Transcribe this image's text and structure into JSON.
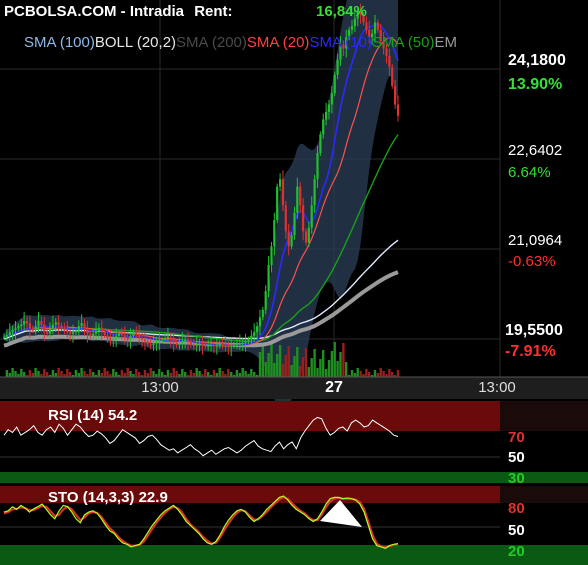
{
  "header": {
    "title": "PCBOLSA.COM - Intradia",
    "rent_label": "Rent:",
    "rent_value": "16,84%"
  },
  "legend": [
    {
      "label": "SMA (100)",
      "color": "#8fb8ea"
    },
    {
      "label": "BOLL (20,2)",
      "color": "#e6e6e6"
    },
    {
      "label": "SMA (200)",
      "color": "#4a4a4a"
    },
    {
      "label": "SMA (20)",
      "color": "#ff4040"
    },
    {
      "label": "SMA (10)",
      "color": "#2a2aff"
    },
    {
      "label": "SMA (50)",
      "color": "#18a018"
    },
    {
      "label": "EM",
      "color": "#9a9a9a"
    }
  ],
  "price_axis": [
    {
      "price": "24,1800",
      "pct": "13.90%",
      "pct_color": "#33e033"
    },
    {
      "price": "22,6402",
      "pct": "6.64%",
      "pct_color": "#33e033"
    },
    {
      "price": "21,0964",
      "pct": "-0.63%",
      "pct_color": "#ff3030"
    },
    {
      "price": "19,5500",
      "pct": "-7.91%",
      "pct_color": "#ff3030"
    }
  ],
  "time_axis": [
    "13:00",
    "27",
    "13:00"
  ],
  "rsi": {
    "label": "RSI (14) 54.2",
    "levels": [
      "70",
      "50",
      "30"
    ],
    "level_colors": [
      "#e03030",
      "#ffffff",
      "#22cc22"
    ]
  },
  "sto": {
    "label": "STO (14,3,3) 22.9",
    "levels": [
      "80",
      "50",
      "20"
    ],
    "level_colors": [
      "#e03030",
      "#ffffff",
      "#22cc22"
    ]
  },
  "chart_data": [
    {
      "type": "candlestick",
      "title": "PCBOLSA.COM - Intradia",
      "ylim": [
        19.3,
        24.35
      ],
      "yticks": [
        24.18,
        22.6402,
        21.0964,
        19.55
      ],
      "xticks": [
        "13:00",
        "27",
        "13:00"
      ],
      "close_series": [
        19.84,
        19.86,
        19.9,
        19.93,
        19.95,
        19.98,
        20.0,
        20.05,
        20.02,
        19.95,
        19.93,
        19.98,
        20.05,
        20.0,
        19.9,
        19.88,
        19.95,
        20.0,
        20.03,
        19.99,
        19.95,
        19.93,
        19.9,
        19.88,
        19.9,
        19.92,
        19.98,
        20.02,
        19.95,
        19.88,
        19.85,
        19.88,
        19.92,
        19.96,
        19.9,
        19.86,
        19.82,
        19.8,
        19.82,
        19.85,
        19.88,
        19.86,
        19.83,
        19.8,
        19.85,
        19.9,
        19.88,
        19.83,
        19.8,
        19.78,
        19.74,
        19.73,
        19.75,
        19.78,
        19.8,
        19.8,
        19.82,
        19.84,
        19.8,
        19.76,
        19.73,
        19.75,
        19.78,
        19.8,
        19.78,
        19.73,
        19.72,
        19.74,
        19.75,
        19.72,
        19.71,
        19.72,
        19.73,
        19.72,
        19.72,
        19.75,
        19.73,
        19.72,
        19.7,
        19.72,
        19.73,
        19.74,
        19.75,
        19.76,
        19.78,
        19.8,
        19.85,
        19.9,
        19.98,
        20.1,
        20.2,
        20.45,
        20.8,
        21.05,
        21.4,
        21.85,
        21.95,
        21.6,
        21.25,
        21.05,
        21.2,
        21.5,
        21.85,
        21.6,
        21.25,
        21.1,
        21.3,
        21.6,
        21.95,
        22.3,
        22.55,
        22.75,
        22.85,
        22.95,
        23.1,
        23.35,
        23.55,
        23.75,
        23.7,
        23.85,
        23.95,
        24.0,
        24.1,
        24.2,
        24.15,
        24.05,
        23.95,
        23.85,
        23.9,
        24.05,
        23.95,
        23.8,
        23.7,
        23.6,
        23.45,
        23.2,
        22.95,
        22.8
      ],
      "volume": "bars shown below price in green/red",
      "overlays": [
        "SMA (100)",
        "BOLL (20,2)",
        "SMA (200)",
        "SMA (20)",
        "SMA (10)",
        "SMA (50)"
      ]
    },
    {
      "type": "line",
      "title": "RSI (14) 54.2",
      "ylim": [
        20,
        80
      ],
      "levels": [
        70,
        50,
        30
      ],
      "series": [
        {
          "name": "RSI (14)",
          "values": [
            55,
            59,
            57,
            61,
            55,
            57,
            59,
            62,
            57,
            55,
            59,
            61,
            57,
            63,
            60,
            55,
            59,
            63,
            61,
            57,
            54,
            55,
            58,
            56,
            53,
            49,
            51,
            55,
            59,
            57,
            55,
            53,
            49,
            51,
            54,
            55,
            52,
            48,
            46,
            44,
            45,
            42,
            44,
            46,
            48,
            45,
            43,
            40,
            42,
            44,
            41,
            43,
            45,
            46,
            44,
            42,
            44,
            47,
            49,
            51,
            47,
            45,
            44,
            43,
            47,
            50,
            45,
            48,
            50,
            45,
            53,
            58,
            62,
            66,
            68,
            67,
            60,
            55,
            57,
            60,
            61,
            58,
            64,
            66,
            64,
            61,
            62,
            66,
            64,
            62,
            60,
            58,
            55,
            54
          ]
        }
      ]
    },
    {
      "type": "line",
      "title": "STO (14,3,3) 22.9",
      "ylim": [
        0,
        100
      ],
      "levels": [
        80,
        50,
        20
      ],
      "series": [
        {
          "name": "STO %K",
          "values": [
            70,
            72,
            78,
            74,
            80,
            76,
            70,
            75,
            78,
            82,
            74,
            66,
            60,
            72,
            80,
            78,
            70,
            60,
            54,
            66,
            70,
            72,
            68,
            60,
            50,
            42,
            38,
            30,
            24,
            22,
            18,
            20,
            22,
            30,
            40,
            50,
            58,
            66,
            72,
            76,
            80,
            74,
            66,
            56,
            50,
            44,
            38,
            30,
            24,
            22,
            26,
            36,
            48,
            58,
            66,
            72,
            74,
            70,
            62,
            56,
            60,
            66,
            74,
            80,
            86,
            92,
            94,
            88,
            80,
            74,
            70,
            66,
            60,
            56,
            60,
            70,
            82,
            90,
            92,
            92,
            90,
            91,
            90,
            88,
            82,
            70,
            50,
            30,
            20,
            18,
            16,
            20,
            22,
            23
          ]
        },
        {
          "name": "STO %D",
          "values": [
            68,
            70,
            74,
            75,
            77,
            76,
            73,
            73,
            76,
            79,
            78,
            71,
            64,
            66,
            74,
            78,
            74,
            66,
            58,
            62,
            68,
            70,
            69,
            63,
            54,
            46,
            40,
            33,
            27,
            23,
            20,
            20,
            21,
            26,
            35,
            45,
            54,
            62,
            69,
            74,
            78,
            76,
            70,
            60,
            52,
            46,
            40,
            33,
            27,
            23,
            24,
            32,
            43,
            53,
            62,
            69,
            73,
            71,
            65,
            59,
            59,
            64,
            70,
            77,
            83,
            89,
            92,
            90,
            83,
            77,
            72,
            68,
            62,
            58,
            58,
            66,
            77,
            86,
            90,
            91,
            90,
            90,
            90,
            89,
            85,
            75,
            56,
            36,
            23,
            19,
            17,
            19,
            21,
            22
          ]
        }
      ]
    }
  ]
}
